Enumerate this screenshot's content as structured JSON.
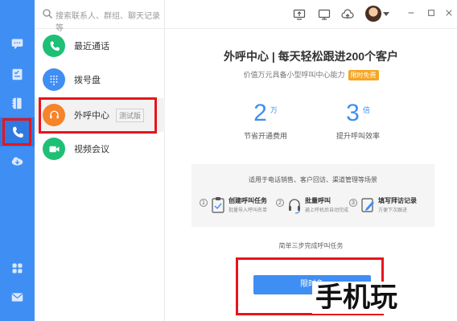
{
  "search": {
    "placeholder": "搜索联系人、群组、聊天记录等"
  },
  "sidebar": {
    "items": [
      {
        "label": "最近通话",
        "icon": "phone-icon",
        "color": "#1fbf76"
      },
      {
        "label": "拨号盘",
        "icon": "dialpad-icon",
        "color": "#3f8ef4"
      },
      {
        "label": "外呼中心",
        "icon": "headset-icon",
        "color": "#f5842a",
        "tag": "测试版"
      },
      {
        "label": "视频会议",
        "icon": "video-icon",
        "color": "#1fbf76"
      }
    ]
  },
  "main": {
    "title": "外呼中心 | 每天轻松跟进200个客户",
    "subtitle": "价值万元具备小型呼叫中心能力",
    "badge": "限时免费",
    "stats": [
      {
        "value": "2",
        "unit": "万",
        "caption": "节省开通费用"
      },
      {
        "value": "3",
        "unit": "倍",
        "caption": "提升呼叫效率"
      }
    ],
    "scene_title": "适用于电话销售、客户回访、渠道管理等场景",
    "steps": [
      {
        "num": "1",
        "title": "创建呼叫任务",
        "desc": "批量导入呼叫名单"
      },
      {
        "num": "2",
        "title": "批量呼叫",
        "desc": "避上呼机后自动完成"
      },
      {
        "num": "3",
        "title": "填写拜访记录",
        "desc": "方便下次跟进"
      }
    ],
    "hint": "简单三步完成呼叫任务",
    "cta": "限时免",
    "watermark": "手机玩"
  },
  "colors": {
    "accent": "#3f8ef4",
    "highlight": "#e8141b"
  }
}
